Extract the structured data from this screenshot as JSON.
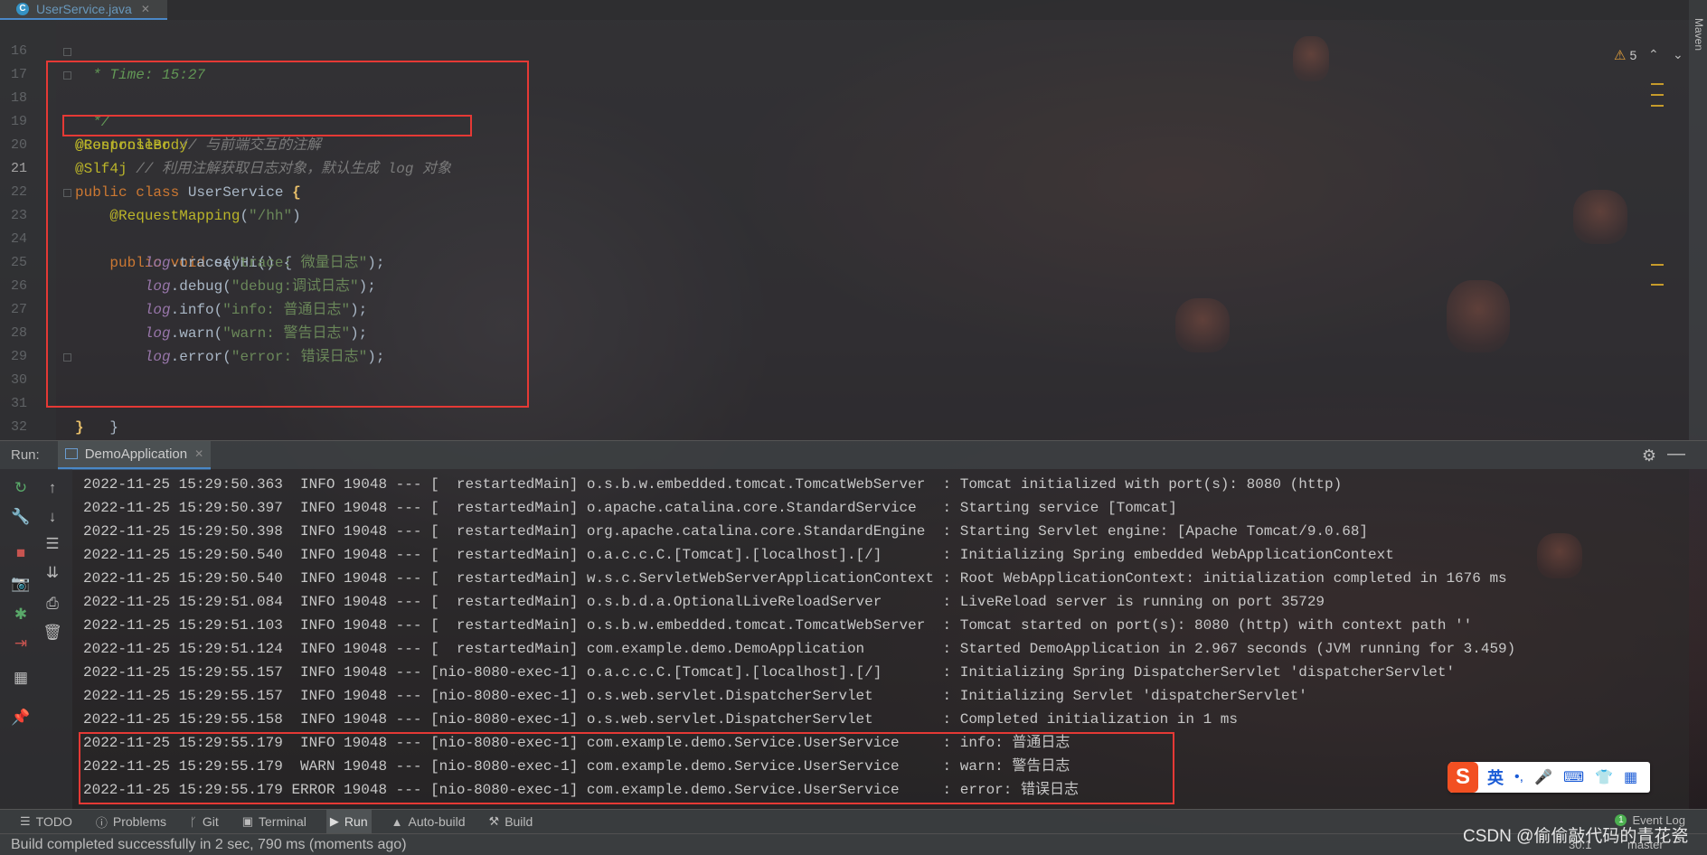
{
  "editor": {
    "tab": {
      "label": "UserService.java",
      "icon_letter": "C"
    },
    "warnings": "5",
    "lines": [
      {
        "num": "16",
        "text": "  * Time: 15:27"
      },
      {
        "num": "17",
        "text": "  */"
      },
      {
        "num": "18",
        "anno": "@Controller",
        "comment": "// 与前端交互的注解"
      },
      {
        "num": "19",
        "anno": "@ResponseBody"
      },
      {
        "num": "20",
        "anno": "@Slf4j",
        "comment": "// 利用注解获取日志对象，默认生成 log 对象"
      },
      {
        "num": "21",
        "kw": "public class",
        "cls": "UserService",
        "brace": "{"
      },
      {
        "num": "22",
        "anno": "@RequestMapping",
        "str": "\"/hh\""
      },
      {
        "num": "23",
        "kw": "public void",
        "rest": "sayHi() {"
      },
      {
        "num": "24",
        "obj": "log",
        "method": ".trace",
        "str": "\"trace: 微量日志\""
      },
      {
        "num": "25",
        "obj": "log",
        "method": ".debug",
        "str": "\"debug:调试日志\""
      },
      {
        "num": "26",
        "obj": "log",
        "method": ".info",
        "str": "\"info: 普通日志\""
      },
      {
        "num": "27",
        "obj": "log",
        "method": ".warn",
        "str": "\"warn: 警告日志\""
      },
      {
        "num": "28",
        "obj": "log",
        "method": ".error",
        "str": "\"error: 错误日志\""
      },
      {
        "num": "29"
      },
      {
        "num": "30",
        "text": "}"
      },
      {
        "num": "31",
        "text": "}"
      },
      {
        "num": "32"
      }
    ]
  },
  "right_bar": {
    "maven": "Maven"
  },
  "run": {
    "label": "Run:",
    "tab_label": "DemoApplication"
  },
  "console": {
    "lines": [
      "2022-11-25 15:29:50.363  INFO 19048 --- [  restartedMain] o.s.b.w.embedded.tomcat.TomcatWebServer  : Tomcat initialized with port(s): 8080 (http)",
      "2022-11-25 15:29:50.397  INFO 19048 --- [  restartedMain] o.apache.catalina.core.StandardService   : Starting service [Tomcat]",
      "2022-11-25 15:29:50.398  INFO 19048 --- [  restartedMain] org.apache.catalina.core.StandardEngine  : Starting Servlet engine: [Apache Tomcat/9.0.68]",
      "2022-11-25 15:29:50.540  INFO 19048 --- [  restartedMain] o.a.c.c.C.[Tomcat].[localhost].[/]       : Initializing Spring embedded WebApplicationContext",
      "2022-11-25 15:29:50.540  INFO 19048 --- [  restartedMain] w.s.c.ServletWebServerApplicationContext : Root WebApplicationContext: initialization completed in 1676 ms",
      "2022-11-25 15:29:51.084  INFO 19048 --- [  restartedMain] o.s.b.d.a.OptionalLiveReloadServer       : LiveReload server is running on port 35729",
      "2022-11-25 15:29:51.103  INFO 19048 --- [  restartedMain] o.s.b.w.embedded.tomcat.TomcatWebServer  : Tomcat started on port(s): 8080 (http) with context path ''",
      "2022-11-25 15:29:51.124  INFO 19048 --- [  restartedMain] com.example.demo.DemoApplication         : Started DemoApplication in 2.967 seconds (JVM running for 3.459)",
      "2022-11-25 15:29:55.157  INFO 19048 --- [nio-8080-exec-1] o.a.c.c.C.[Tomcat].[localhost].[/]       : Initializing Spring DispatcherServlet 'dispatcherServlet'",
      "2022-11-25 15:29:55.157  INFO 19048 --- [nio-8080-exec-1] o.s.web.servlet.DispatcherServlet        : Initializing Servlet 'dispatcherServlet'",
      "2022-11-25 15:29:55.158  INFO 19048 --- [nio-8080-exec-1] o.s.web.servlet.DispatcherServlet        : Completed initialization in 1 ms",
      "2022-11-25 15:29:55.179  INFO 19048 --- [nio-8080-exec-1] com.example.demo.Service.UserService     : info: 普通日志",
      "2022-11-25 15:29:55.179  WARN 19048 --- [nio-8080-exec-1] com.example.demo.Service.UserService     : warn: 警告日志",
      "2022-11-25 15:29:55.179 ERROR 19048 --- [nio-8080-exec-1] com.example.demo.Service.UserService     : error: 错误日志"
    ]
  },
  "toolstrip": {
    "todo": "TODO",
    "problems": "Problems",
    "git": "Git",
    "terminal": "Terminal",
    "run": "Run",
    "auto_build": "Auto-build",
    "build": "Build",
    "event_count": "1",
    "event_log": "Event Log"
  },
  "status": {
    "message": "Build completed successfully in 2 sec, 790 ms (moments ago)",
    "position": "30:1",
    "branch": "master"
  },
  "watermark": "CSDN @偷偷敲代码的青花瓷",
  "ime": {
    "logo": "S",
    "lang": "英"
  }
}
